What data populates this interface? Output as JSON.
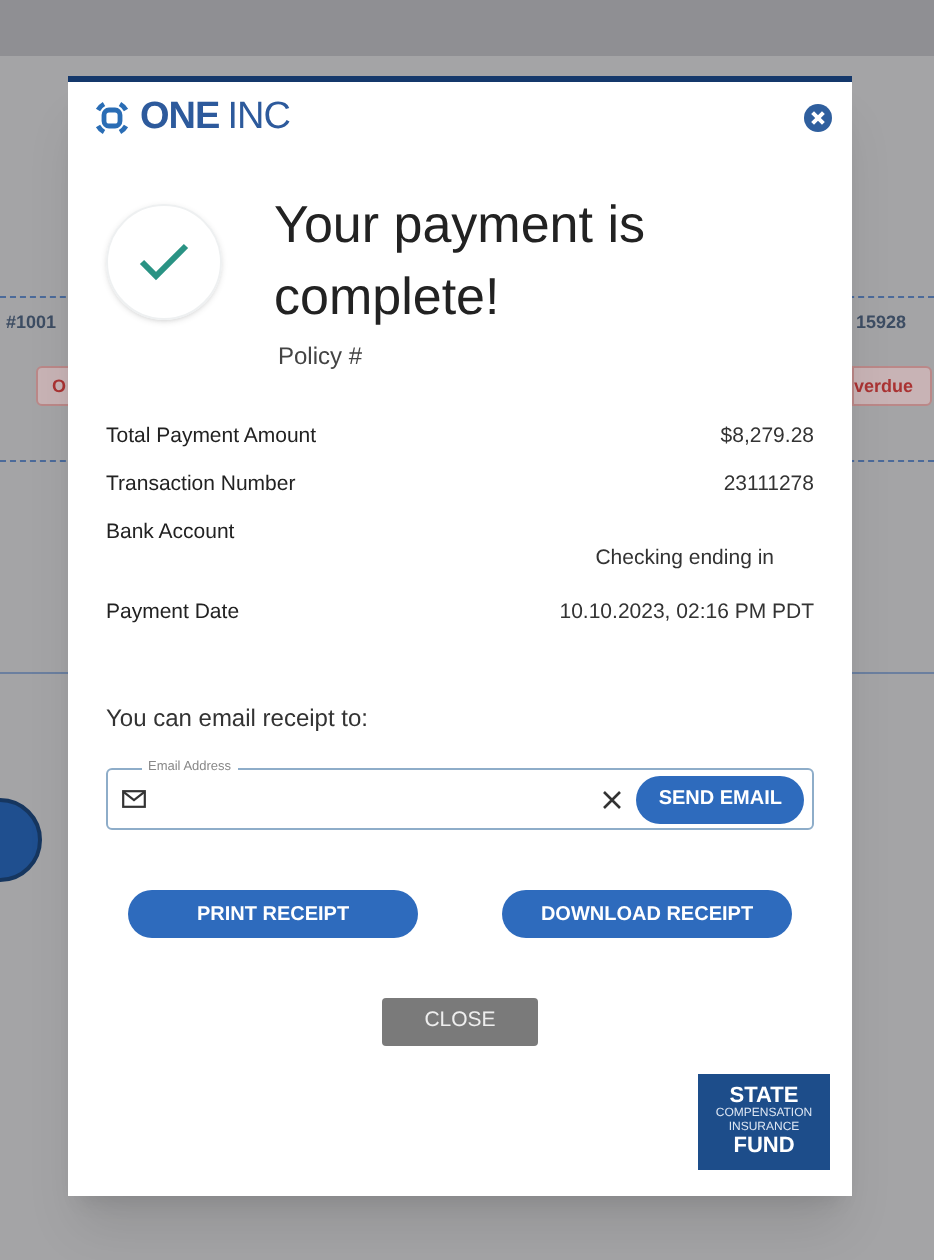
{
  "background": {
    "left_id": "#1001",
    "right_id": "15928",
    "left_badge": "O",
    "right_badge": "verdue"
  },
  "dialog": {
    "logo": {
      "bold": "ONE",
      "light": "INC"
    },
    "title": "Your payment is complete!",
    "policy_label": "Policy #",
    "details": [
      {
        "label": "Total Payment Amount",
        "value": "$8,279.28"
      },
      {
        "label": "Transaction Number",
        "value": "23111278"
      },
      {
        "label": "Bank Account",
        "value": "Checking ending in"
      },
      {
        "label": "Payment Date",
        "value": "10.10.2023, 02:16 PM PDT"
      }
    ],
    "email_prompt": "You can email receipt to:",
    "email_field": {
      "label": "Email Address"
    },
    "send_button": "SEND EMAIL",
    "actions": [
      "PRINT RECEIPT",
      "DOWNLOAD RECEIPT"
    ],
    "close_button": "CLOSE",
    "footer_logo": {
      "top": "STATE",
      "middle": [
        "COMPENSATION",
        "INSURANCE"
      ],
      "bottom": "FUND"
    }
  }
}
